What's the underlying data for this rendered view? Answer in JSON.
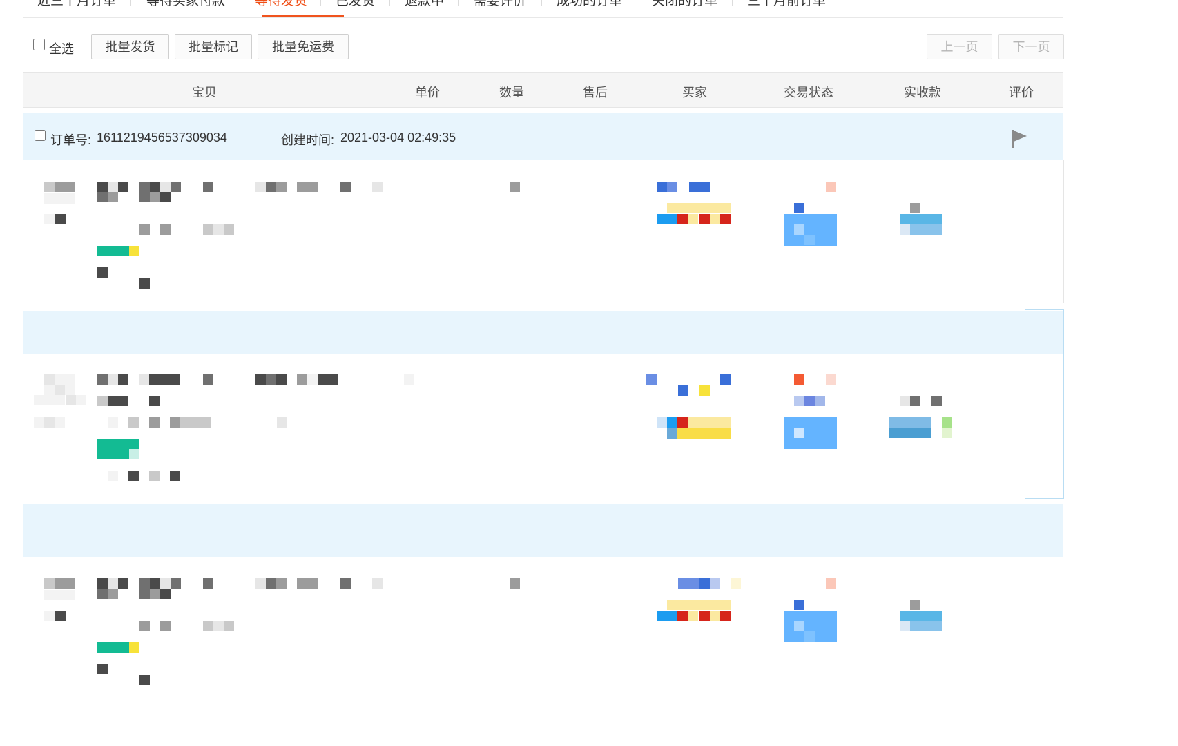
{
  "tabs": [
    {
      "label": "近三个月订单",
      "active": false
    },
    {
      "label": "等待买家付款",
      "active": false
    },
    {
      "label": "等待发货",
      "active": true
    },
    {
      "label": "已发货",
      "active": false
    },
    {
      "label": "退款中",
      "active": false
    },
    {
      "label": "需要评价",
      "active": false
    },
    {
      "label": "成功的订单",
      "active": false
    },
    {
      "label": "关闭的订单",
      "active": false
    },
    {
      "label": "三个月前订单",
      "active": false
    }
  ],
  "toolbar": {
    "select_all_label": "全选",
    "batch_ship_label": "批量发货",
    "batch_mark_label": "批量标记",
    "batch_free_shipping_label": "批量免运费",
    "prev_page_label": "上一页",
    "next_page_label": "下一页"
  },
  "table_headers": {
    "item": "宝贝",
    "unit_price": "单价",
    "quantity": "数量",
    "after_sale": "售后",
    "buyer": "买家",
    "status": "交易状态",
    "received": "实收款",
    "review": "评价"
  },
  "orders": [
    {
      "order_no_label": "订单号:",
      "order_no": "1611219456537309034",
      "created_label": "创建时间:",
      "created_time": "2021-03-04 02:49:35"
    }
  ],
  "colors": {
    "accent": "#f04e16",
    "order_header_bg": "#e8f5fd",
    "status_button_blue": "#64b4ff",
    "tag_green": "#13bb93"
  }
}
